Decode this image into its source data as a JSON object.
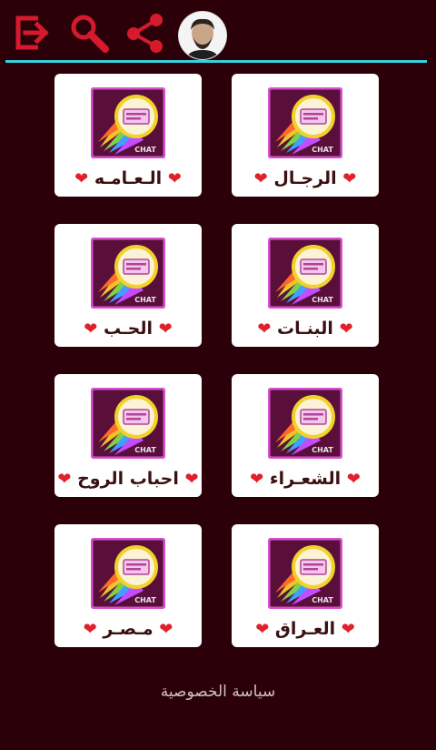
{
  "toolbar": {
    "exit_icon": "exit-icon",
    "search_icon": "search-icon",
    "share_icon": "share-icon",
    "accent_color": "#d41a2c",
    "divider_color": "#39d0dc"
  },
  "rooms": [
    {
      "label": "الرجـال",
      "heart": "❤"
    },
    {
      "label": "الـعـامـه",
      "heart": "❤"
    },
    {
      "label": "البنـات",
      "heart": "❤"
    },
    {
      "label": "الحـب",
      "heart": "❤"
    },
    {
      "label": "الشعـراء",
      "heart": "❤"
    },
    {
      "label": "احباب الروح",
      "heart": "❤"
    },
    {
      "label": "العـراق",
      "heart": "❤"
    },
    {
      "label": "مـصـر",
      "heart": "❤"
    }
  ],
  "footer": {
    "privacy_label": "سياسة الخصوصية"
  }
}
